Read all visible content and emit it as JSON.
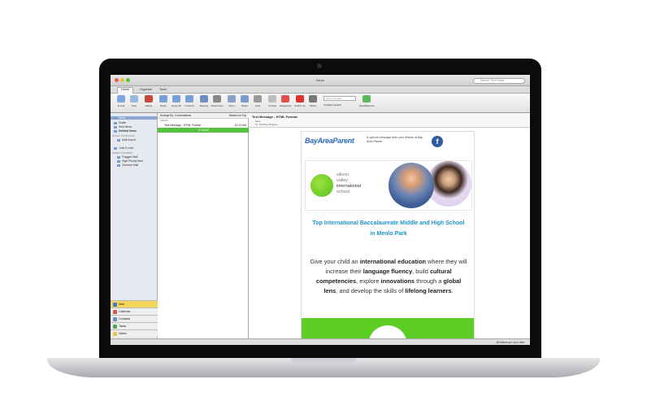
{
  "window": {
    "title": "Inbox",
    "search_placeholder": "Search This Folder"
  },
  "tabs": [
    "Home",
    "Organize",
    "Tools"
  ],
  "ribbon": [
    {
      "label": "E-mail",
      "icon": "email-icon",
      "color": "#7fa8dd"
    },
    {
      "label": "New",
      "icon": "new-icon",
      "color": "#9bb8e0"
    },
    {
      "label": "Delete",
      "icon": "delete-icon",
      "color": "#c44a3a"
    },
    {
      "label": "Reply",
      "icon": "reply-icon",
      "color": "#7a9fd4"
    },
    {
      "label": "Reply All",
      "icon": "reply-all-icon",
      "color": "#7a9fd4"
    },
    {
      "label": "Forward",
      "icon": "forward-icon",
      "color": "#7a9fd4"
    },
    {
      "label": "Meeting",
      "icon": "meeting-icon",
      "color": "#6f8ec0"
    },
    {
      "label": "Attachment",
      "icon": "attachment-icon",
      "color": "#888888"
    },
    {
      "label": "Move",
      "icon": "move-icon",
      "color": "#8aa0c8"
    },
    {
      "label": "Rules",
      "icon": "rules-icon",
      "color": "#7e9bd0"
    },
    {
      "label": "Junk",
      "icon": "junk-icon",
      "color": "#9a9a9a"
    },
    {
      "label": "Unread",
      "icon": "unread-icon",
      "color": "#bdbdbd"
    },
    {
      "label": "Categorize",
      "icon": "categorize-icon",
      "color": "#e04f4f"
    },
    {
      "label": "Follow Up",
      "icon": "flag-icon",
      "color": "#d9332f"
    },
    {
      "label": "Filters",
      "icon": "filter-icon",
      "color": "#777777"
    },
    {
      "label": "Contacts Search",
      "icon": "contacts-search-icon",
      "color": "#bbbbbb"
    },
    {
      "label": "Send/Receive",
      "icon": "send-receive-icon",
      "color": "#5cb85c"
    }
  ],
  "ribbon_extra": {
    "find_contact": "Find a Contact"
  },
  "sidebar": {
    "inbox": "Inbox",
    "folders": [
      "Drafts",
      "Sent Items",
      "Deleted Items"
    ],
    "on_my_computer": "ON MY COMPUTER",
    "local": [
      "Mail Import"
    ],
    "junk": "Junk E-mail",
    "smart_folders_header": "SMART FOLDERS",
    "smart": [
      "Flagged Mail",
      "High Priority Mail",
      "Overdue Mail"
    ],
    "nav": [
      "Mail",
      "Calendar",
      "Contacts",
      "Tasks",
      "Notes"
    ]
  },
  "msglist": {
    "arrange": "Arrange By: Conversations",
    "order": "Newest on Top",
    "group": "TODAY",
    "subject": "Test Message - HTML Format",
    "time": "10:13 AM",
    "selected_time": "10:13 AM"
  },
  "reading": {
    "subject": "Test Message - HTML Format:",
    "sender": "Sent:",
    "to": "To: Timothy Chapero"
  },
  "email": {
    "logo": "BayAreaParent",
    "tagline": "A special message from your friends at Bay Area Parent",
    "fb": "f",
    "sv_line1": "silicon",
    "sv_line2": "valley",
    "sv_line3": "international",
    "sv_line4": "school",
    "headline": "Top International Baccalaureate Middle and High School in Menlo Park",
    "body_1": "Give your child an ",
    "body_b1": "international education",
    "body_2": " where they will increase their ",
    "body_b2": "language fluency",
    "body_3": ", build ",
    "body_b3": "cultural competencies",
    "body_4": ", explore ",
    "body_b4": "innovations",
    "body_5": " through a ",
    "body_b5": "global lens",
    "body_6": ", and develop the skills of ",
    "body_b6": "lifelong learners",
    "body_7": "."
  },
  "status": {
    "right": "All folders are up to date."
  }
}
